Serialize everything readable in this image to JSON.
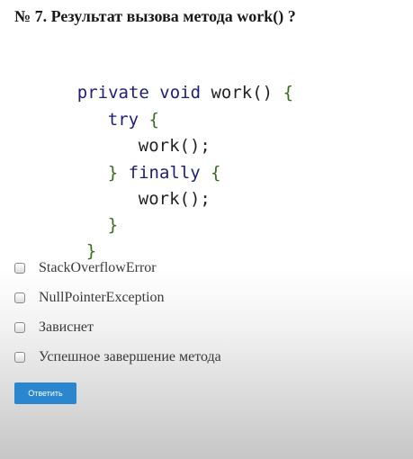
{
  "question": {
    "title": "№ 7. Результат вызова метода work() ?"
  },
  "code": {
    "l1_kw": "private void",
    "l1_name": " work() ",
    "l1_brace": "{",
    "l2_kw": "try",
    "l2_brace": " {",
    "l3": "work();",
    "l4_brace_close": "}",
    "l4_kw": " finally",
    "l4_brace_open": " {",
    "l5": "work();",
    "l6": "}",
    "l7": "}"
  },
  "options": [
    {
      "label": "StackOverflowError"
    },
    {
      "label": "NullPointerException"
    },
    {
      "label": "Зависнет"
    },
    {
      "label": "Успешное завершение метода"
    }
  ],
  "submit_label": "Ответить",
  "colors": {
    "keyword": "#1d1d7a",
    "brace": "#3a6a1e",
    "button": "#2a86cf"
  }
}
